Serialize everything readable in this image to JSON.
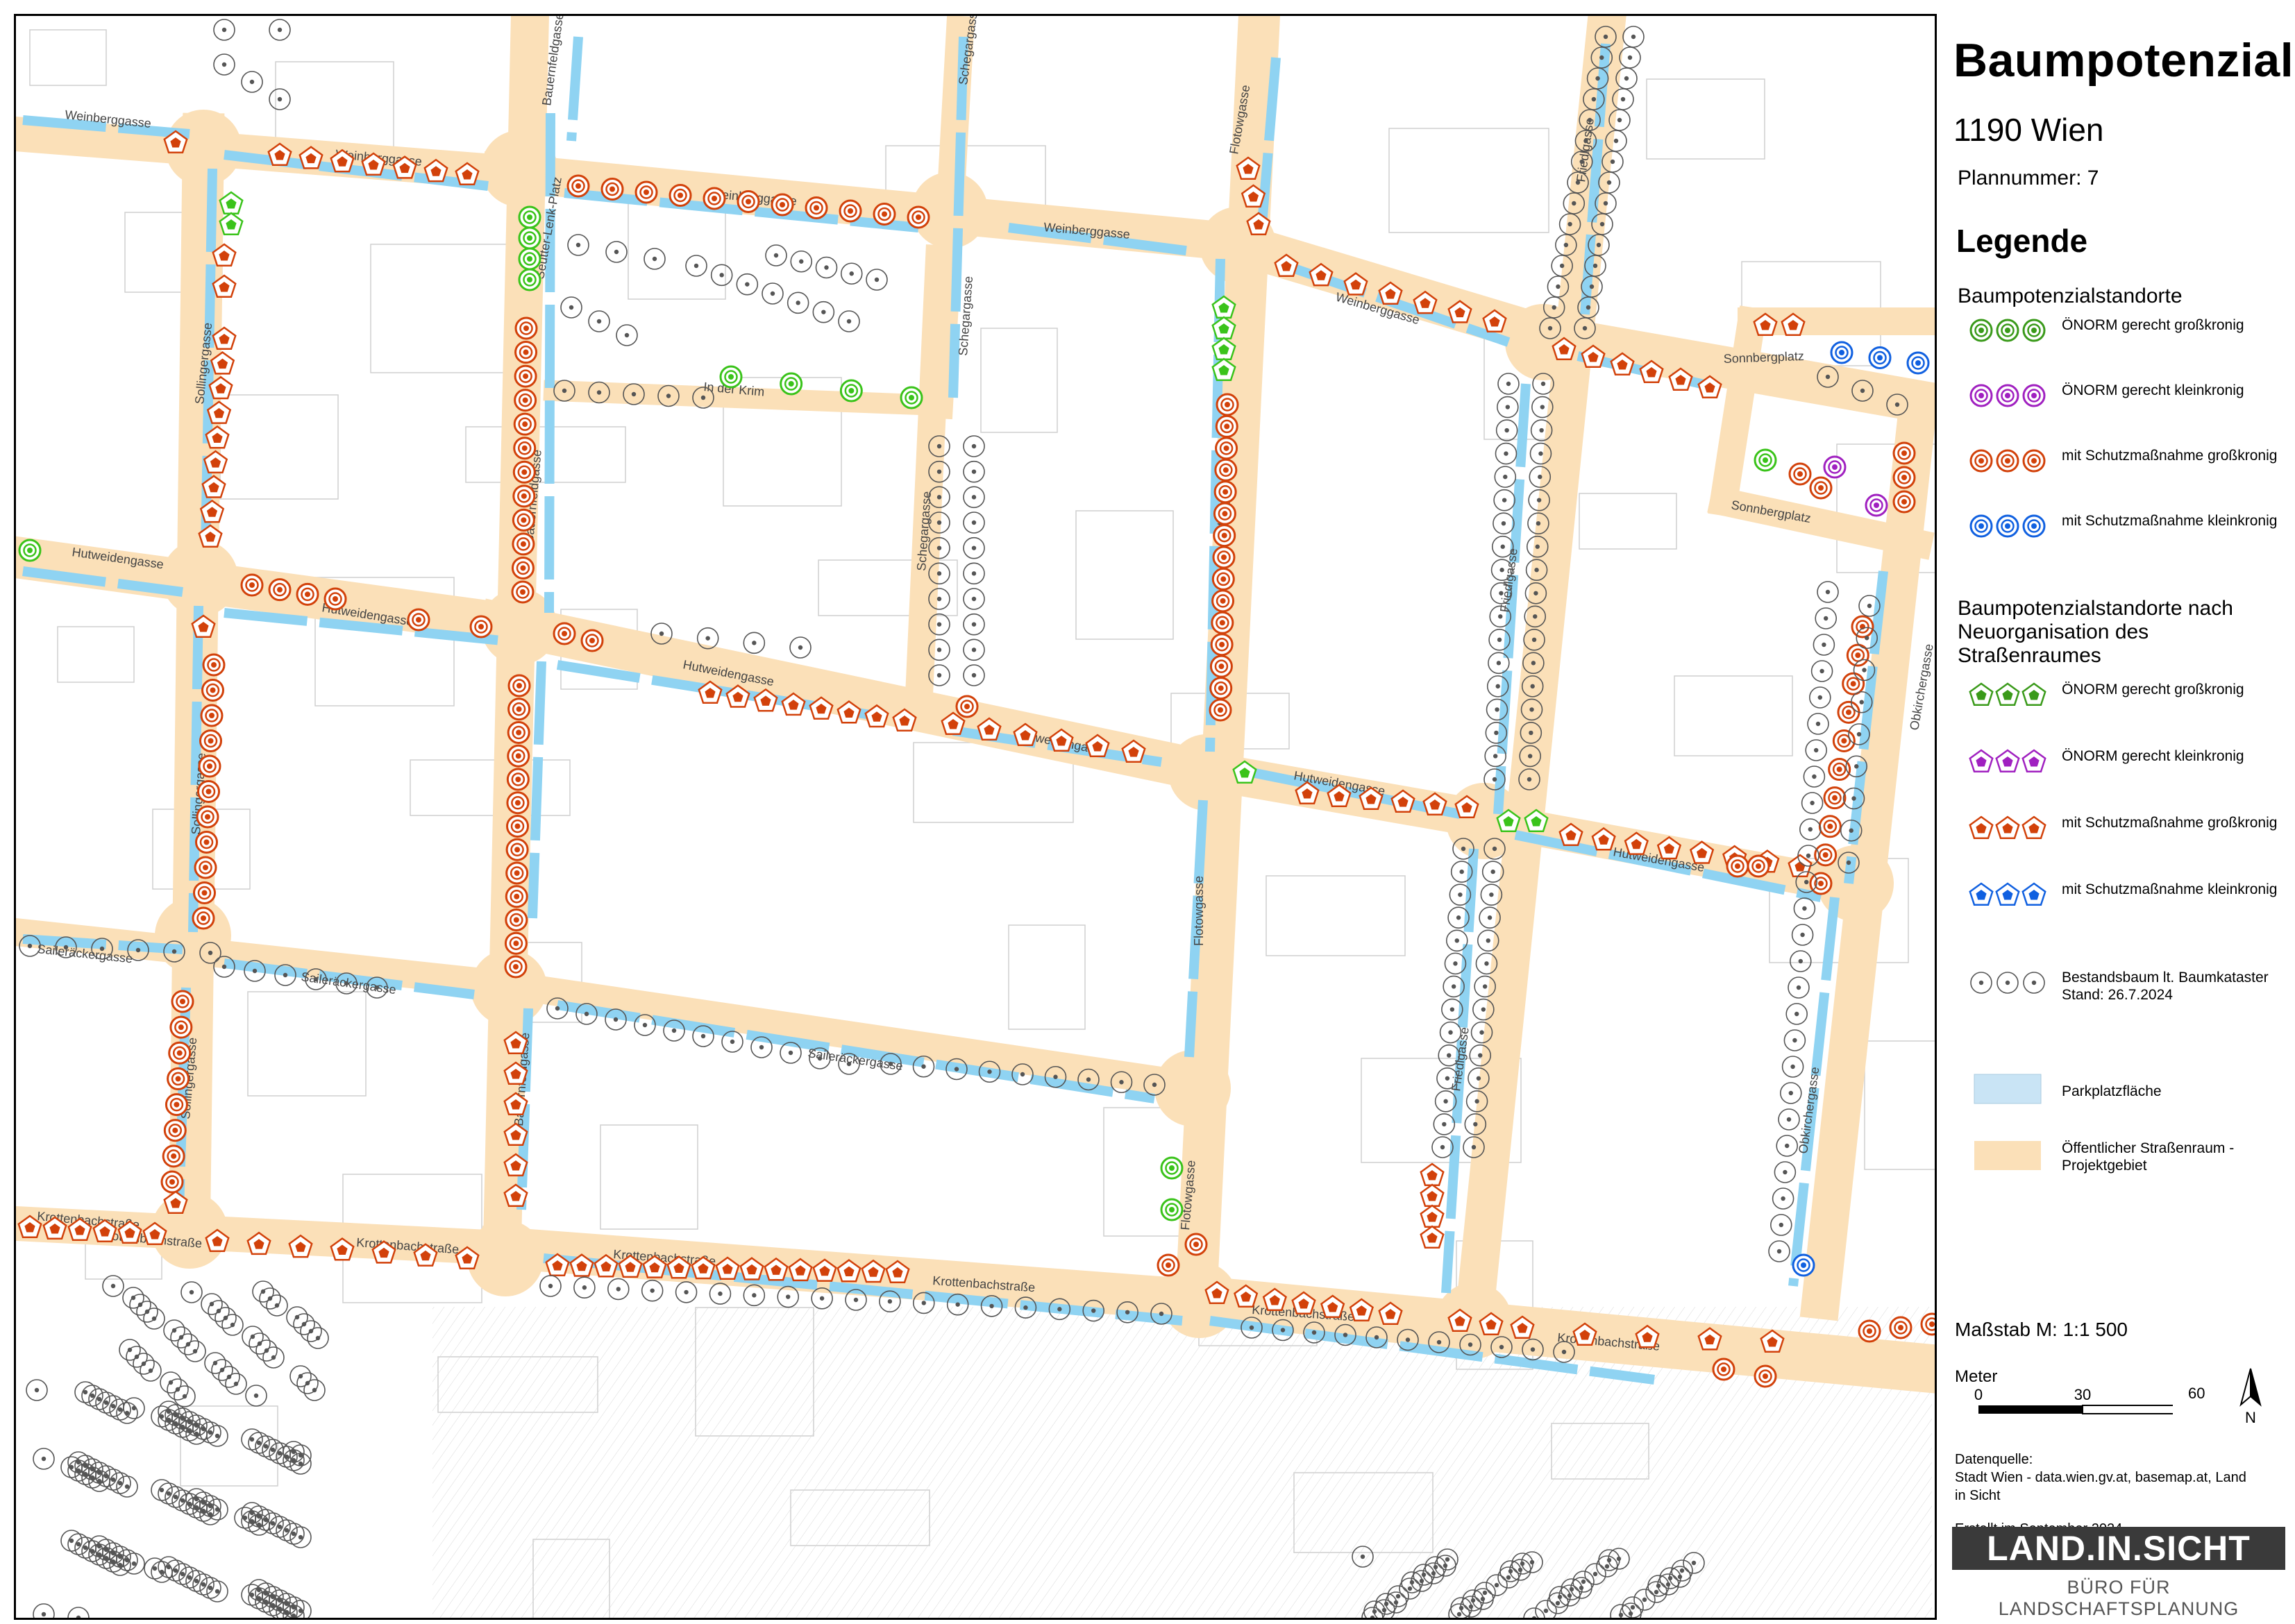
{
  "title": "Baumpotenzial",
  "district": "1190 Wien",
  "plan_number": "Plannummer: 7",
  "legend": {
    "heading": "Legende",
    "group1_title": "Baumpotenzialstandorte",
    "group1_items": [
      {
        "label": "ÖNORM gerecht großkronig",
        "color": "#3a9a1a",
        "shape": "circle"
      },
      {
        "label": "ÖNORM gerecht kleinkronig",
        "color": "#a020c0",
        "shape": "circle"
      },
      {
        "label": "mit Schutzmaßnahme großkronig",
        "color": "#d2410a",
        "shape": "circle"
      },
      {
        "label": "mit Schutzmaßnahme kleinkronig",
        "color": "#1060e0",
        "shape": "circle"
      }
    ],
    "group2_title": "Baumpotenzialstandorte nach Neuorganisation des Straßenraumes",
    "group2_items": [
      {
        "label": "ÖNORM gerecht großkronig",
        "color": "#3a9a1a",
        "shape": "pentagon"
      },
      {
        "label": "ÖNORM gerecht kleinkronig",
        "color": "#a020c0",
        "shape": "pentagon"
      },
      {
        "label": "mit Schutzmaßnahme großkronig",
        "color": "#d2410a",
        "shape": "pentagon"
      },
      {
        "label": "mit Schutzmaßnahme kleinkronig",
        "color": "#1060e0",
        "shape": "pentagon"
      }
    ],
    "existing_tree": {
      "label": "Bestandsbaum lt. Baumkataster Stand: 26.7.2024",
      "color": "#555555"
    },
    "parking": {
      "label": "Parkplatzfläche",
      "color": "#c9e4f5"
    },
    "street_area": {
      "label": "Öffentlicher Straßenraum - Projektgebiet",
      "color": "#fbe0b8"
    }
  },
  "scale": {
    "label": "Maßstab M: 1:1 500",
    "unit": "Meter",
    "ticks": [
      "0",
      "30",
      "60"
    ],
    "north": "N"
  },
  "source": {
    "heading": "Datenquelle:",
    "text": "Stadt Wien - data.wien.gv.at, basemap.at, Land in Sicht",
    "created": "Erstellt im September 2024"
  },
  "logo": {
    "name": "LAND.IN.SICHT",
    "tagline": "BÜRO FÜR LANDSCHAFTSPLANUNG"
  },
  "colors": {
    "street": "#fbe0b8",
    "parking": "#8fd3f2",
    "orange": "#d2410a",
    "green": "#3ac31a",
    "purple": "#a020c0",
    "blue": "#1060e0",
    "existing": "#555555"
  },
  "street_labels": [
    "Weinberggasse",
    "Weinberggasse",
    "Weinberggasse",
    "Weinberggasse",
    "Weinberggasse",
    "Hutweidengasse",
    "Hutweidengasse",
    "Hutweidengasse",
    "Hutweidengasse",
    "Hutweidengasse",
    "Hutweidengasse",
    "Saileräckergasse",
    "Saileräckergasse",
    "Saileräckergasse",
    "Krottenbachstraße",
    "Krottenbachstraße",
    "Krottenbachstraße",
    "Krottenbachstraße",
    "Krottenbachstraße",
    "Krottenbachstraße",
    "Krottenbachstraße",
    "Flotowgasse",
    "Flotowgasse",
    "Flotowgasse",
    "Flotowgasse",
    "Friedlgasse",
    "Friedlgasse",
    "Friedlgasse",
    "Obkirchergasse",
    "Obkirchergasse",
    "Sollingergasse",
    "Sollingergasse",
    "Sollingergasse",
    "Bauernfeldgasse",
    "Bauernfeldgasse",
    "Bauernfeldgasse",
    "Schegargasse",
    "Schegargasse",
    "Schegargasse",
    "In der Krim",
    "Sonnbergplatz",
    "Sonnbergplatz",
    "Seutter-Lenk-Platz"
  ]
}
